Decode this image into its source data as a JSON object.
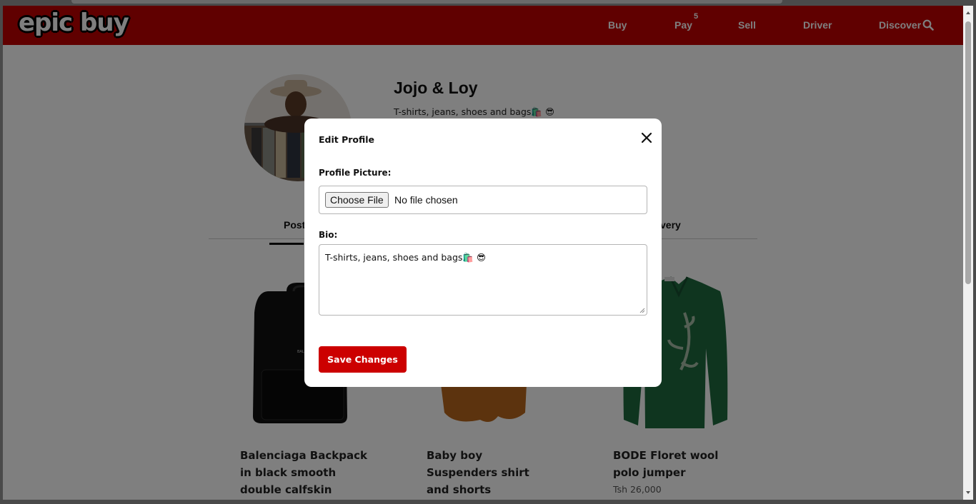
{
  "navbar": {
    "logo": "epic buy",
    "items": [
      {
        "label": "Buy"
      },
      {
        "label": "Pay",
        "badge": "5"
      },
      {
        "label": "Sell"
      },
      {
        "label": "Driver"
      },
      {
        "label": "Discover"
      }
    ],
    "search_icon": "search-icon"
  },
  "profile": {
    "name": "Jojo & Loy",
    "bio": "T-shirts, jeans, shoes and bags🛍️ 😎",
    "tabs": [
      {
        "label": "Post"
      },
      {
        "label": "very"
      }
    ]
  },
  "products": [
    {
      "title": "Balenciaga Backpack in black smooth double calfskin",
      "price": ""
    },
    {
      "title": "Baby boy Suspenders shirt and shorts",
      "price": ""
    },
    {
      "title": "BODE Floret wool polo jumper",
      "price": "Tsh 26,000"
    }
  ],
  "modal": {
    "title": "Edit Profile",
    "profile_picture_label": "Profile Picture:",
    "choose_file_label": "Choose File",
    "file_status": "No file chosen",
    "bio_label": "Bio:",
    "bio_value": "T-shirts, jeans, shoes and bags🛍️ 😎",
    "save_label": "Save Changes",
    "close_icon": "close-icon"
  },
  "colors": {
    "brand_red": "#c00000",
    "button_red": "#cc0000",
    "overlay": "rgba(0,0,0,0.5)"
  }
}
